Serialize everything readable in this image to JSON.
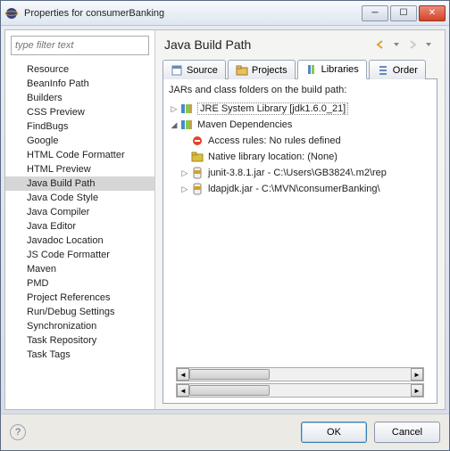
{
  "window": {
    "title": "Properties for consumerBanking"
  },
  "filter": {
    "placeholder": "type filter text"
  },
  "leftTree": {
    "items": [
      "Resource",
      "BeanInfo Path",
      "Builders",
      "CSS Preview",
      "FindBugs",
      "Google",
      "HTML Code Formatter",
      "HTML Preview",
      "Java Build Path",
      "Java Code Style",
      "Java Compiler",
      "Java Editor",
      "Javadoc Location",
      "JS Code Formatter",
      "Maven",
      "PMD",
      "Project References",
      "Run/Debug Settings",
      "Synchronization",
      "Task Repository",
      "Task Tags"
    ],
    "selected": "Java Build Path"
  },
  "rightHeader": {
    "title": "Java Build Path"
  },
  "tabs": {
    "items": [
      "Source",
      "Projects",
      "Libraries",
      "Order"
    ],
    "active": "Libraries"
  },
  "libDesc": "JARs and class folders on the build path:",
  "libTree": [
    {
      "level": 0,
      "expander": "▷",
      "icon": "lib",
      "label": "JRE System Library [jdk1.6.0_21]",
      "dotted": true
    },
    {
      "level": 0,
      "expander": "◢",
      "icon": "lib",
      "label": "Maven Dependencies"
    },
    {
      "level": 1,
      "expander": "",
      "icon": "rules",
      "label": "Access rules: No rules defined"
    },
    {
      "level": 1,
      "expander": "",
      "icon": "native",
      "label": "Native library location: (None)"
    },
    {
      "level": 1,
      "expander": "▷",
      "icon": "jar",
      "label": "junit-3.8.1.jar - C:\\Users\\GB3824\\.m2\\rep"
    },
    {
      "level": 1,
      "expander": "▷",
      "icon": "jar",
      "label": "ldapjdk.jar - C:\\MVN\\consumerBanking\\"
    }
  ],
  "footer": {
    "ok": "OK",
    "cancel": "Cancel"
  }
}
